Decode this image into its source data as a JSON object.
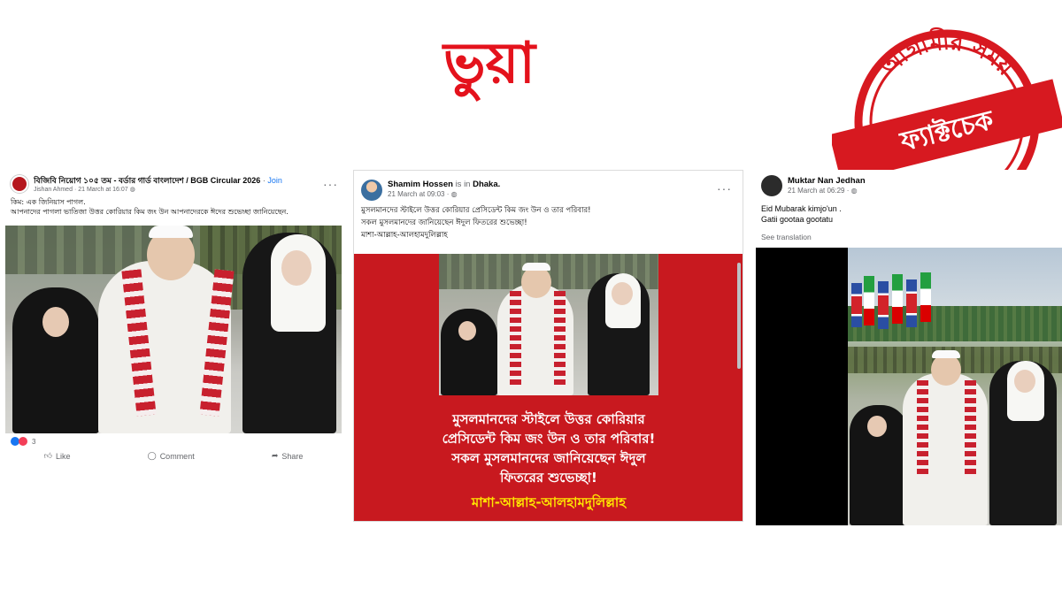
{
  "headline": {
    "label": "ভুয়া",
    "color": "#e4121c"
  },
  "seal": {
    "top_text": "আগামীর সময়",
    "ribbon_text": "ফ্যাক্টচেক",
    "color": "#d71920"
  },
  "post1": {
    "group": "বিজিবি নিয়োগ ১০৫ তম - বর্ডার গার্ড বাংলাদেশ / BGB Circular 2026",
    "join": "Join",
    "author": "Jishan Ahmed",
    "time": "21 March at 16:07",
    "caption_line1": "কিম: এক জিনিয়াস পাগল.",
    "caption_line2": "আপনাদের পাগলা ভাতিজা উত্তর কোরিয়ার কিম জং উন আপনাদেরকে ঈদের শুভেচ্ছা জানিয়েছেন.",
    "reactions": "3",
    "like": "Like",
    "comment": "Comment",
    "share": "Share"
  },
  "post2": {
    "author": "Shamim Hossen",
    "is_in": "is in",
    "place": "Dhaka.",
    "time": "21 March at 09:03",
    "caption_line1": "মুসলমানদের স্টাইলে উত্তর কোরিয়ার প্রেসিডেন্ট কিম জং উন ও তার পরিবার!",
    "caption_line2": "সকল মুসলমানদের জানিয়েছেন ঈদুল ফিতরের শুভেচ্ছা!",
    "caption_line3": "মাশা-আল্লাহ-আলহামদুলিল্লাহ",
    "banner_line1": "মুসলমানদের স্টাইলে উত্তর কোরিয়ার",
    "banner_line2": "প্রেসিডেন্ট কিম জং উন ও তার পরিবার!",
    "banner_line3": "সকল মুসলমানদের জানিয়েছেন ঈদুল",
    "banner_line4": "ফিতরের শুভেচ্ছা!",
    "banner_line5": "মাশা-আল্লাহ-আলহামদুলিল্লাহ",
    "banner_color": "#c8191f"
  },
  "post3": {
    "author": "Muktar Nan Jedhan",
    "time": "21 March at 06:29",
    "caption_line1": "Eid Mubarak kimjo'un .",
    "caption_line2": "Gatii gootaa gootatu",
    "see_translation": "See translation"
  }
}
